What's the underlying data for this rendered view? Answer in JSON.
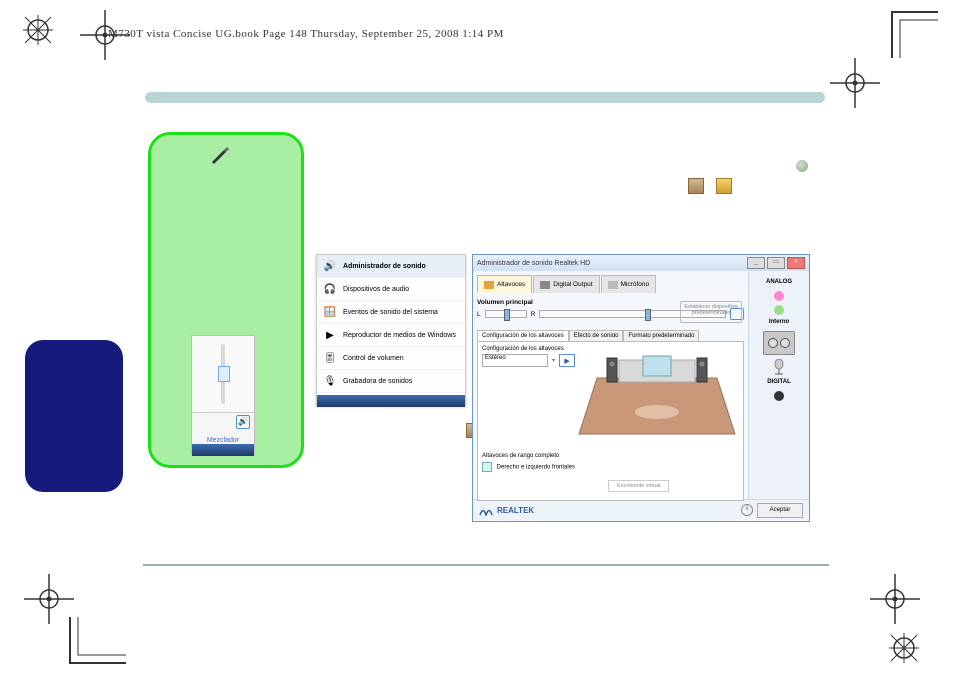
{
  "header": "M730T vista Concise UG.book  Page 148  Thursday, September 25, 2008  1:14 PM",
  "volume_popup": {
    "mixer_link": "Mezclador"
  },
  "sound_menu": {
    "items": [
      {
        "label": "Administrador de sonido",
        "icon": "speaker"
      },
      {
        "label": "Dispositivos de audio",
        "icon": "devices"
      },
      {
        "label": "Eventos de sonido del sistema",
        "icon": "events"
      },
      {
        "label": "Reproductor de medios de Windows",
        "icon": "wmp"
      },
      {
        "label": "Control de volumen",
        "icon": "volume"
      },
      {
        "label": "Grabadora de sonidos",
        "icon": "recorder"
      }
    ]
  },
  "realtek": {
    "title": "Administrador de sonido Realtek HD",
    "tabs": {
      "speakers": "Altavoces",
      "digital": "Digital Output",
      "mic": "Micrófono"
    },
    "main_volume_label": "Volumen principal",
    "balance_left": "L",
    "balance_right": "R",
    "default_device": "Establecer dispositivo predeterminado",
    "subtabs": {
      "config": "Configuración de los altavoces",
      "effects": "Efecto de sonido",
      "format": "Formato predeterminado"
    },
    "config_label": "Configuración de los altavoces",
    "speaker_select": "Estéreo",
    "fullrange_title": "Altavoces de rango completo",
    "fullrange_option": "Derecho e izquierdo frontales",
    "virtual_surround": "Envolvente virtual",
    "side": {
      "analog": "ANALOG",
      "internal": "Interno",
      "digital": "DIGITAL"
    },
    "brand": "REALTEK",
    "ok": "Aceptar"
  }
}
